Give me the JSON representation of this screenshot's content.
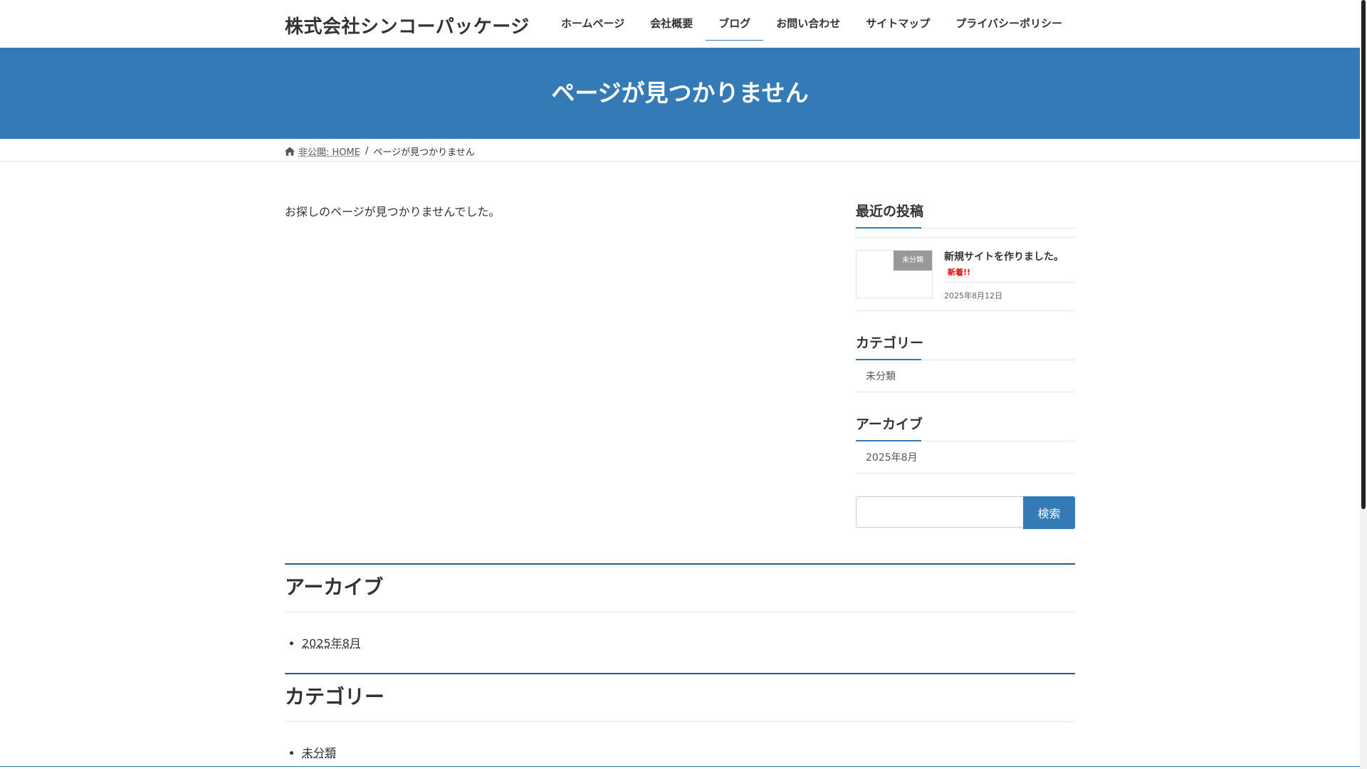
{
  "header": {
    "site_title": "株式会社シンコーパッケージ",
    "nav": [
      {
        "label": "ホームページ"
      },
      {
        "label": "会社概要"
      },
      {
        "label": "ブログ"
      },
      {
        "label": "お問い合わせ"
      },
      {
        "label": "サイトマップ"
      },
      {
        "label": "プライバシーポリシー"
      }
    ],
    "active_nav": "ブログ"
  },
  "page_header": {
    "title": "ページが見つかりません"
  },
  "breadcrumb": {
    "home": "非公開: HOME",
    "separator": "/",
    "current": "ページが見つかりません"
  },
  "main": {
    "message": "お探しのページが見つかりませんでした。"
  },
  "sidebar": {
    "recent_posts": {
      "title": "最近の投稿",
      "items": [
        {
          "category_badge": "未分類",
          "title": "新規サイトを作りました。",
          "new_label": "新着!!",
          "date": "2025年8月12日"
        }
      ]
    },
    "categories": {
      "title": "カテゴリー",
      "items": [
        "未分類"
      ]
    },
    "archives": {
      "title": "アーカイブ",
      "items": [
        "2025年8月"
      ]
    },
    "search": {
      "button_label": "検索",
      "value": ""
    }
  },
  "bottom": {
    "archives": {
      "title": "アーカイブ",
      "items": [
        "2025年8月"
      ]
    },
    "categories": {
      "title": "カテゴリー",
      "items": [
        "未分類"
      ]
    }
  },
  "colors": {
    "accent": "#337ab7",
    "new_badge": "#ee0000",
    "category_badge": "#999999"
  }
}
